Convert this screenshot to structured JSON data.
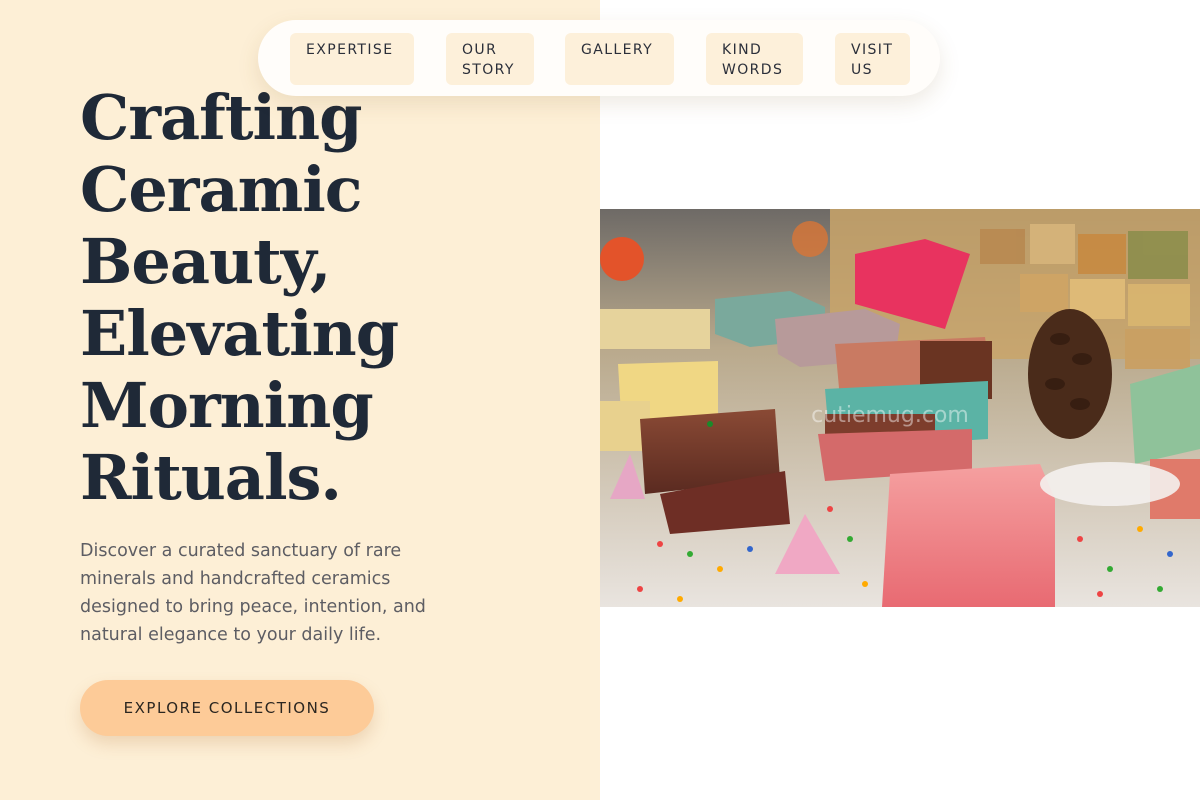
{
  "nav": {
    "items": [
      {
        "lines": [
          "EXPERTISE"
        ]
      },
      {
        "lines": [
          "OUR",
          "STORY"
        ]
      },
      {
        "lines": [
          "GALLERY"
        ]
      },
      {
        "lines": [
          "KIND",
          "WORDS"
        ]
      },
      {
        "lines": [
          "VISIT",
          "US"
        ]
      }
    ]
  },
  "hero": {
    "title_lines": [
      "Crafting",
      "Ceramic",
      "Beauty,",
      "Elevating",
      "Morning",
      "Rituals."
    ],
    "description_lines": [
      "Discover a curated sanctuary of rare",
      "minerals and handcrafted ceramics",
      "designed to bring peace, intention, and",
      "natural elegance to your daily life."
    ],
    "cta_label": "EXPLORE COLLECTIONS"
  },
  "image": {
    "subject": "handmade soap bars with pinecone and sprinkles",
    "watermark": "cutiemug.com"
  },
  "colors": {
    "left_panel_bg": "#fdefd6",
    "nav_item_bg": "#fdf0da",
    "cta_bg": "#fdcb98",
    "title_text": "#1f2937",
    "body_text": "#5d5d63"
  }
}
